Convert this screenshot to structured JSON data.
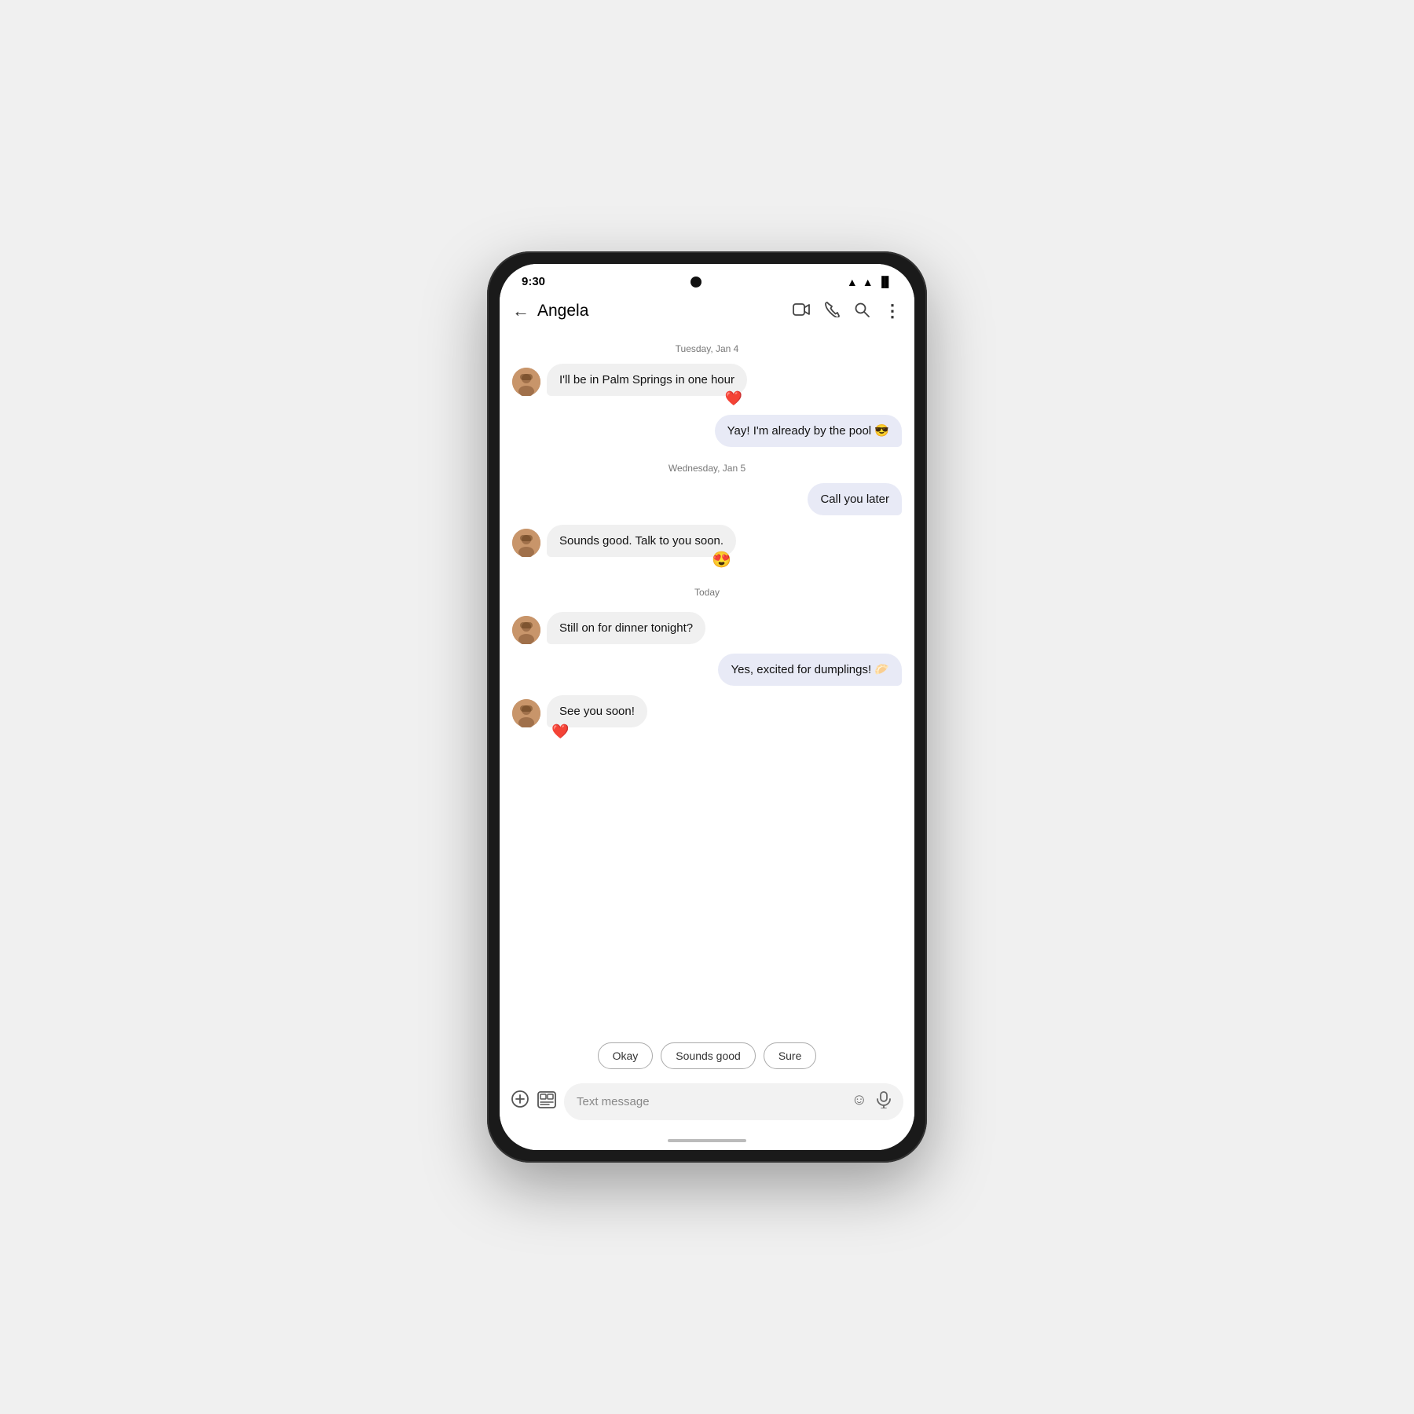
{
  "phone": {
    "status_bar": {
      "time": "9:30",
      "camera_label": "front-camera"
    },
    "app_bar": {
      "back_label": "←",
      "contact_name": "Angela",
      "actions": [
        "video-call",
        "phone-call",
        "search",
        "more"
      ]
    },
    "chat": {
      "date_labels": [
        "Tuesday, Jan 4",
        "Wednesday, Jan 5",
        "Today"
      ],
      "messages": [
        {
          "id": "msg1",
          "type": "received",
          "text": "I'll be in Palm Springs in one hour",
          "reaction": "❤️",
          "reaction_pos": "right"
        },
        {
          "id": "msg2",
          "type": "sent",
          "text": "Yay! I'm already by the pool 😎",
          "reaction": null
        },
        {
          "id": "msg3",
          "type": "sent",
          "text": "Call you later",
          "reaction": null
        },
        {
          "id": "msg4",
          "type": "received",
          "text": "Sounds good. Talk to you soon.",
          "reaction": "😍",
          "reaction_pos": "right"
        },
        {
          "id": "msg5",
          "type": "received",
          "text": "Still on for dinner tonight?",
          "reaction": null
        },
        {
          "id": "msg6",
          "type": "sent",
          "text": "Yes, excited for dumplings! 🥟",
          "reaction": null
        },
        {
          "id": "msg7",
          "type": "received",
          "text": "See you soon!",
          "reaction": "❤️",
          "reaction_pos": "center"
        }
      ]
    },
    "quick_replies": [
      "Okay",
      "Sounds good",
      "Sure"
    ],
    "input_bar": {
      "placeholder": "Text message",
      "add_icon": "+",
      "media_icon": "⊡",
      "emoji_icon": "☺",
      "mic_icon": "🎤"
    }
  }
}
